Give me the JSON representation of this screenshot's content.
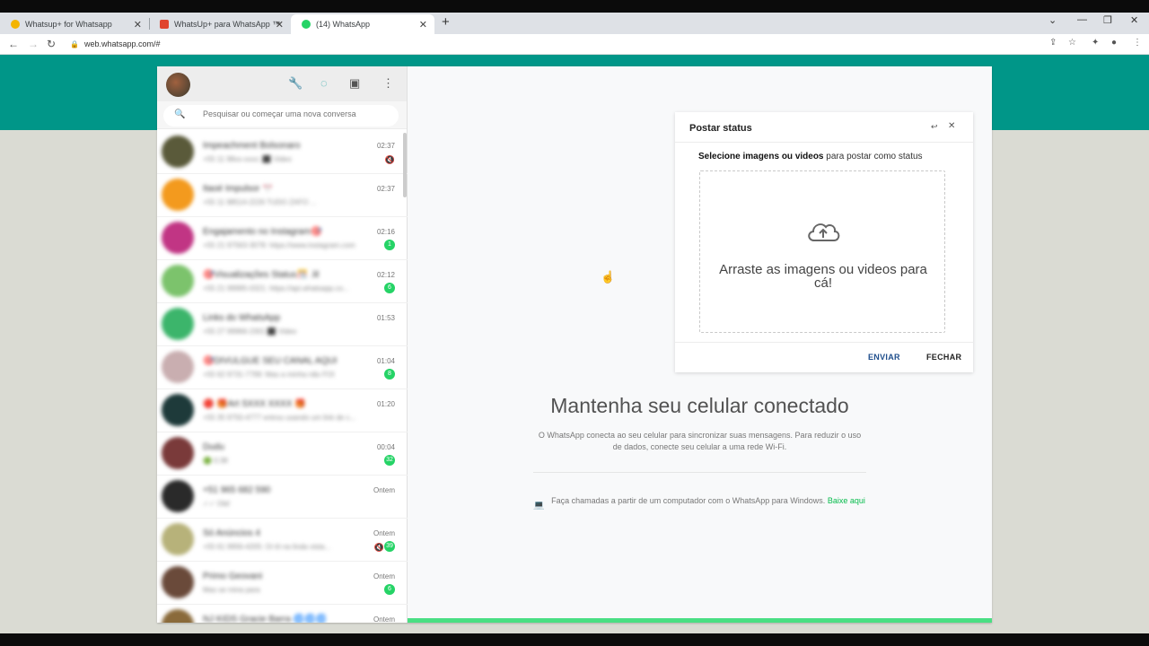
{
  "browser": {
    "tabs": [
      {
        "title": "Whatsup+ for Whatsapp",
        "color": "#f4b400"
      },
      {
        "title": "WhatsUp+ para WhatsApp ™ - C",
        "color": "#e0452e"
      },
      {
        "title": "(14) WhatsApp",
        "color": "#25d366"
      }
    ],
    "new_tab": "+",
    "url": "web.whatsapp.com/#"
  },
  "sidebar": {
    "search_placeholder": "Pesquisar ou começar uma nova conversa",
    "chats": [
      {
        "name": "Impeachment Bolsonaro",
        "msg": "+55 11 98xx-xxxx: ⬛ Video",
        "time": "02:37",
        "badge": "",
        "muted": true,
        "color": "#5a5a3a"
      },
      {
        "name": "Itaoé Impulsor 🎌",
        "msg": "+55 11 98514-2226 TUDO ZAFO ...",
        "time": "02:37",
        "badge": "",
        "muted": false,
        "color": "#f39a1e"
      },
      {
        "name": "Engajamento no Instagram🎯",
        "msg": "+55 21 97563-3078: https://www.instagram.com...",
        "time": "02:16",
        "badge": "1",
        "muted": false,
        "color": "#c13584"
      },
      {
        "name": "🎯Visualizações Status🎊 .lil",
        "msg": "+55 21 99995-0321: https://api.whatsapp.co...",
        "time": "02:12",
        "badge": "6",
        "muted": false,
        "color": "#7cc36c"
      },
      {
        "name": "Links do WhatsApp",
        "msg": "+55 27 99966-2301 ⬛ Video",
        "time": "01:53",
        "badge": "",
        "muted": false,
        "color": "#3cb56b"
      },
      {
        "name": "🎯DIVULGUE SEU CANAL AQUI",
        "msg": "+55 62 9731-7799: Mas a minha não FOI",
        "time": "01:04",
        "badge": "8",
        "muted": false,
        "color": "#c9aeb0"
      },
      {
        "name": "🔴 🎁Art SXXX XXXX 🎁",
        "msg": "+55 35 9750-4777 entrou usando um link de c...",
        "time": "01:20",
        "badge": "",
        "muted": false,
        "color": "#1e3a3a"
      },
      {
        "name": "Dudu",
        "msg": "🟢 0:38",
        "time": "00:04",
        "badge": "32",
        "muted": false,
        "color": "#7a3a3a"
      },
      {
        "name": "+51 965 682 590",
        "msg": "✓✓ Olá!",
        "time": "Ontem",
        "badge": "",
        "muted": false,
        "color": "#2a2a2a"
      },
      {
        "name": "Só Anúncios 4",
        "msg": "+55 61 9956-4205: Oi tô na linda vista...",
        "time": "Ontem",
        "badge": "39",
        "muted": true,
        "color": "#b7b27a"
      },
      {
        "name": "Primo Geovani",
        "msg": "Mas se mina para",
        "time": "Ontem",
        "badge": "6",
        "muted": false,
        "color": "#6a4a3a"
      },
      {
        "name": "NJ KIDS Gracie Barra 🌀🌀🌀",
        "msg": "...",
        "time": "Ontem",
        "badge": "",
        "muted": false,
        "color": "#8a6a3a"
      }
    ]
  },
  "main": {
    "title": "Mantenha seu celular conectado",
    "desc": "O WhatsApp conecta ao seu celular para sincronizar suas mensagens. Para reduzir o uso de dados, conecte seu celular a uma rede Wi-Fi.",
    "windows_text": "Faça chamadas a partir de um computador com o WhatsApp para Windows.",
    "windows_link": "Baixe aqui"
  },
  "modal": {
    "title": "Postar status",
    "min_icon": "↩",
    "close_icon": "✕",
    "instr_bold": "Selecione imagens ou videos",
    "instr_rest": " para postar como status",
    "drop_text": "Arraste as imagens ou videos para cá!",
    "send_label": "ENVIAR",
    "close_label": "FECHAR"
  }
}
